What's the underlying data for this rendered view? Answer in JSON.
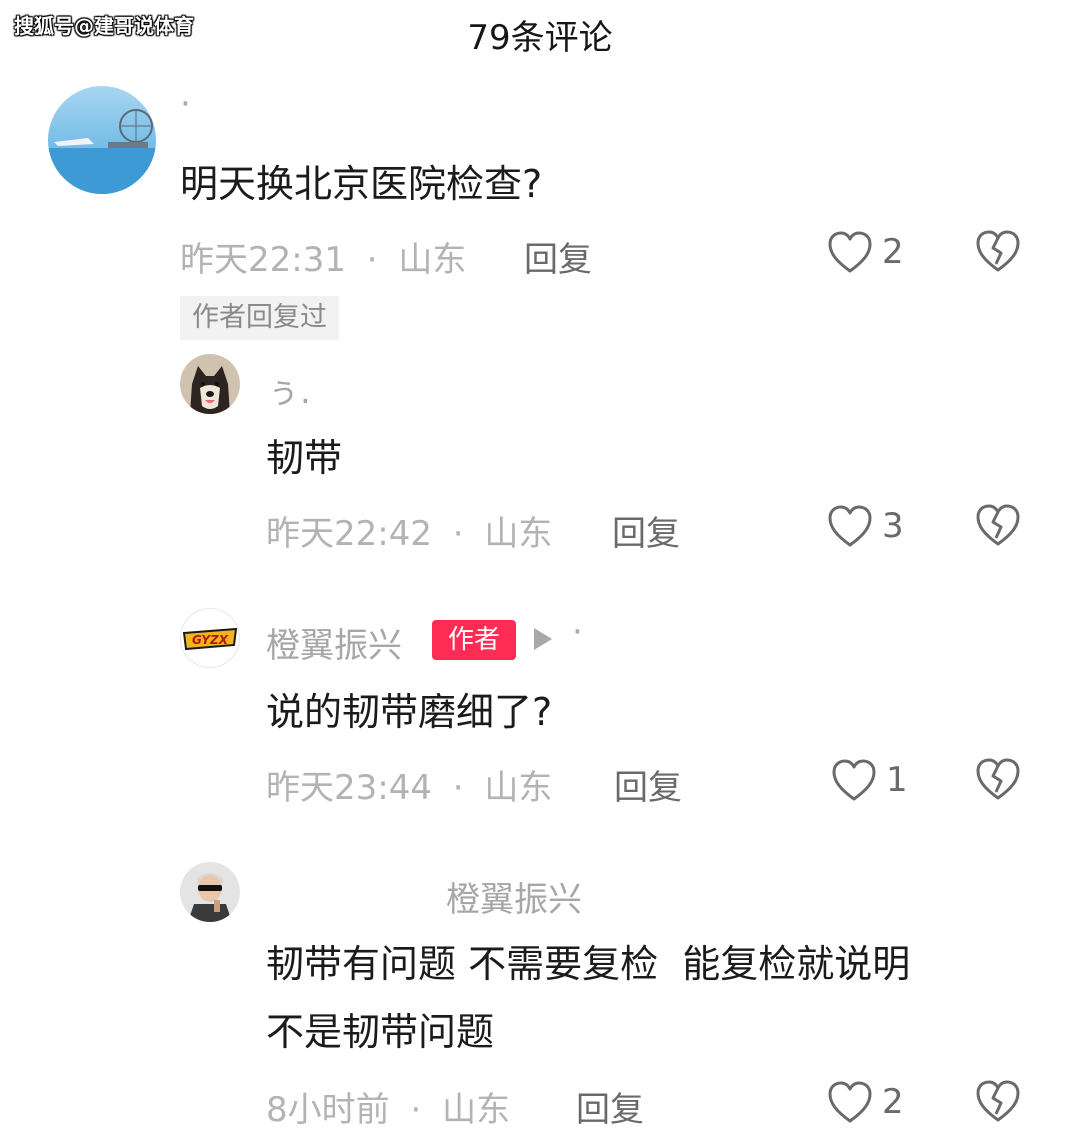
{
  "watermark": "搜狐号@建哥说体育",
  "header": {
    "title": "79条评论"
  },
  "comments": [
    {
      "username": "·",
      "text": "明天换北京医院检查?",
      "time": "昨天22:31",
      "separator": "·",
      "location": "山东",
      "reply_label": "回复",
      "likes": "2",
      "author_replied": "作者回复过"
    },
    {
      "username": "ぅ.",
      "text": "韧带",
      "time": "昨天22:42",
      "separator": "·",
      "location": "山东",
      "reply_label": "回复",
      "likes": "3"
    },
    {
      "username": "橙翼振兴",
      "author_badge": "作者",
      "reply_to": "·",
      "text": "说的韧带磨细了?",
      "time": "昨天23:44",
      "separator": "·",
      "location": "山东",
      "reply_label": "回复",
      "likes": "1"
    },
    {
      "reply_to": "橙翼振兴",
      "text_line1": "韧带有问题 不需要复检  能复检就说明",
      "text_line2": "不是韧带问题",
      "time": "8小时前",
      "separator": "·",
      "location": "山东",
      "reply_label": "回复",
      "likes": "2"
    }
  ],
  "icons": {
    "like": "heart-outline-icon",
    "dislike": "broken-heart-icon",
    "play": "play-triangle-icon"
  },
  "colors": {
    "author_badge_bg": "#fe2c55",
    "meta_text": "#b3b3b3",
    "body_text": "#1b1b1b"
  }
}
